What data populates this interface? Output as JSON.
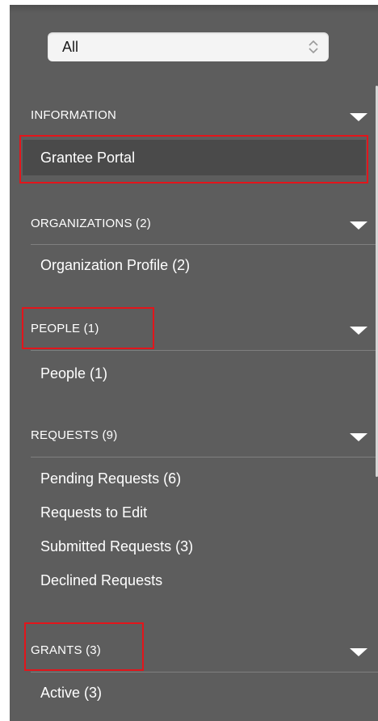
{
  "filter": {
    "selected": "All"
  },
  "sections": [
    {
      "key": "information",
      "label": "INFORMATION",
      "items": [
        {
          "label": "Grantee Portal"
        }
      ]
    },
    {
      "key": "organizations",
      "label": "ORGANIZATIONS (2)",
      "items": [
        {
          "label": "Organization Profile  (2)"
        }
      ]
    },
    {
      "key": "people",
      "label": "PEOPLE (1)",
      "items": [
        {
          "label": "People  (1)"
        }
      ]
    },
    {
      "key": "requests",
      "label": "REQUESTS (9)",
      "items": [
        {
          "label": "Pending Requests  (6)"
        },
        {
          "label": "Requests to Edit"
        },
        {
          "label": "Submitted Requests  (3)"
        },
        {
          "label": "Declined Requests"
        }
      ]
    },
    {
      "key": "grants",
      "label": "GRANTS (3)",
      "items": [
        {
          "label": "Active  (3)"
        }
      ]
    }
  ],
  "colors": {
    "panel": "#5d5d5d",
    "active_item": "#4a4a4a",
    "highlight": "#e3151b"
  }
}
